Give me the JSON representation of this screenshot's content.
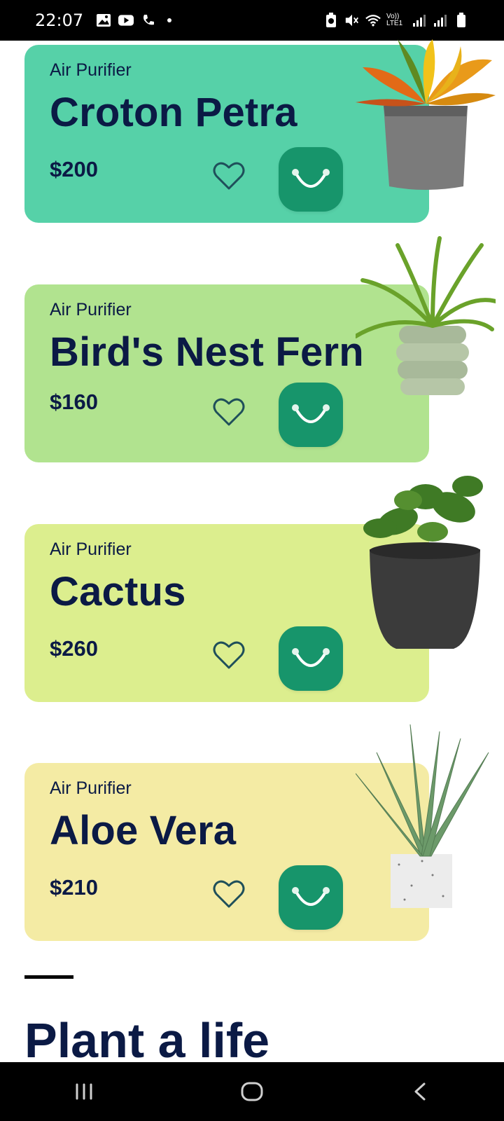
{
  "status_bar": {
    "time": "22:07",
    "network_label": "Vo)) LTE1"
  },
  "products": [
    {
      "category": "Air Purifier",
      "name": "Croton Petra",
      "price": "$200",
      "color": "#56d1a8",
      "plant_icon": "croton-plant-image"
    },
    {
      "category": "Air Purifier",
      "name": "Bird's Nest Fern",
      "price": "$160",
      "color": "#b1e38f",
      "plant_icon": "fern-plant-image"
    },
    {
      "category": "Air Purifier",
      "name": "Cactus",
      "price": "$260",
      "color": "#dcee8e",
      "plant_icon": "cactus-plant-image"
    },
    {
      "category": "Air Purifier",
      "name": "Aloe Vera",
      "price": "$210",
      "color": "#f4eba4",
      "plant_icon": "aloe-plant-image"
    }
  ],
  "section": {
    "title": "Plant a life"
  },
  "colors": {
    "cart_button": "#17956b",
    "text_dark": "#0b1a45"
  },
  "nav": {
    "recents_icon": "recents-icon",
    "home_icon": "home-icon",
    "back_icon": "back-icon"
  }
}
